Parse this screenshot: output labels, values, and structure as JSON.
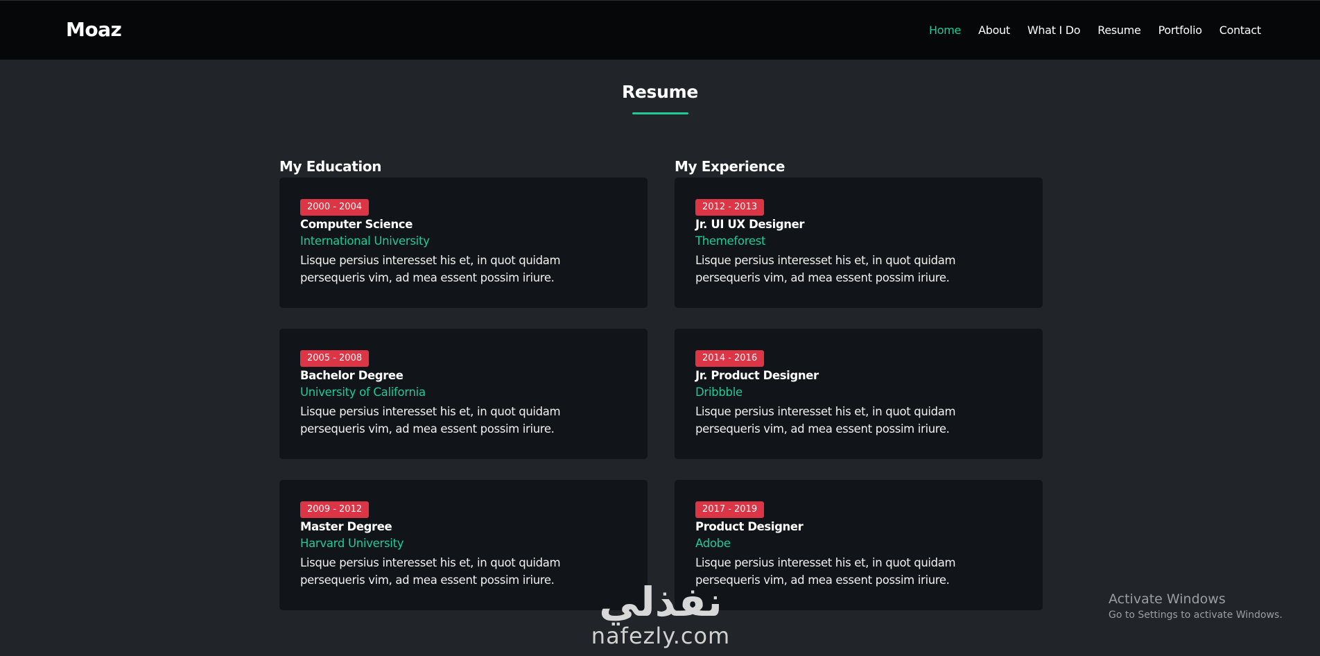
{
  "brand": "Moaz",
  "nav": [
    {
      "label": "Home",
      "active": true
    },
    {
      "label": "About",
      "active": false
    },
    {
      "label": "What I Do",
      "active": false
    },
    {
      "label": "Resume",
      "active": false
    },
    {
      "label": "Portfolio",
      "active": false
    },
    {
      "label": "Contact",
      "active": false
    }
  ],
  "section_title": "Resume",
  "education": {
    "heading": "My Education",
    "items": [
      {
        "years": "2000 - 2004",
        "title": "Computer Science",
        "org": "International University",
        "desc": "Lisque persius interesset his et, in quot quidam persequeris vim, ad mea essent possim iriure."
      },
      {
        "years": "2005 - 2008",
        "title": "Bachelor Degree",
        "org": "University of California",
        "desc": "Lisque persius interesset his et, in quot quidam persequeris vim, ad mea essent possim iriure."
      },
      {
        "years": "2009 - 2012",
        "title": "Master Degree",
        "org": "Harvard University",
        "desc": "Lisque persius interesset his et, in quot quidam persequeris vim, ad mea essent possim iriure."
      }
    ]
  },
  "experience": {
    "heading": "My Experience",
    "items": [
      {
        "years": "2012 - 2013",
        "title": "Jr. UI UX Designer",
        "org": "Themeforest",
        "desc": "Lisque persius interesset his et, in quot quidam persequeris vim, ad mea essent possim iriure."
      },
      {
        "years": "2014 - 2016",
        "title": "Jr. Product Designer",
        "org": "Dribbble",
        "desc": "Lisque persius interesset his et, in quot quidam persequeris vim, ad mea essent possim iriure."
      },
      {
        "years": "2017 - 2019",
        "title": "Product Designer",
        "org": "Adobe",
        "desc": "Lisque persius interesset his et, in quot quidam persequeris vim, ad mea essent possim iriure."
      }
    ]
  },
  "watermark": {
    "arabic": "نفذلي",
    "latin": "nafezly.com"
  },
  "activation": {
    "title": "Activate Windows",
    "subtitle": "Go to Settings to activate Windows."
  },
  "colors": {
    "accent": "#20c997",
    "badge": "#dc3545",
    "page_bg": "#212529",
    "card_bg": "#111418",
    "nav_bg": "#050708"
  }
}
